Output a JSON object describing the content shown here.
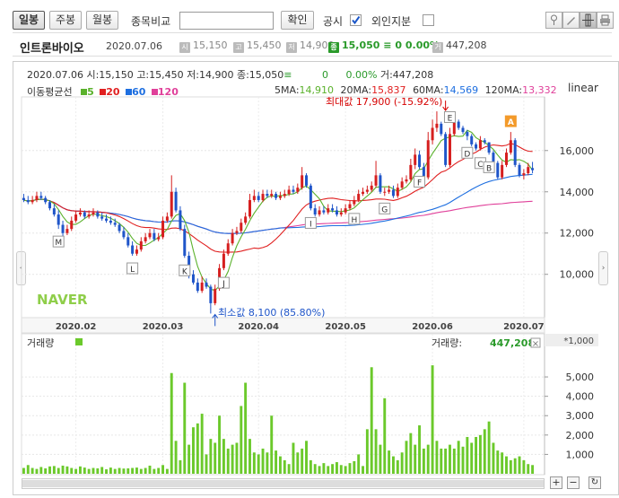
{
  "toolbar": {
    "tabs": [
      "일봉",
      "주봉",
      "월봉"
    ],
    "compare_label": "종목비교",
    "compare_value": "",
    "confirm_label": "확인",
    "notice_label": "공시",
    "notice_checked": true,
    "foreign_label": "외인지분",
    "foreign_checked": false,
    "tools": [
      "pin-icon",
      "pencil-icon",
      "crosshair-icon",
      "print-icon"
    ]
  },
  "stock": {
    "name": "인트론바이오",
    "date": "2020.07.06",
    "open_label": "시",
    "open": "15,150",
    "high_label": "고",
    "high": "15,450",
    "low_label": "저",
    "low": "14,900",
    "close_label": "종",
    "close": "15,050",
    "change_mark": "≡",
    "change": "0",
    "change_pct": "0.00%",
    "volume_label": "거",
    "volume": "447,208"
  },
  "info_line": {
    "date": "2020.07.06",
    "open": "시:15,150",
    "high": "고:15,450",
    "low": "저:14,900",
    "close": "종:15,050",
    "close_mark": "≡",
    "change": "0",
    "change_pct": "0.00%",
    "volume": "거:447,208"
  },
  "ma_legend": {
    "title": "이동평균선",
    "items": [
      {
        "label": "5",
        "color": "#5ab12b"
      },
      {
        "label": "20",
        "color": "#e02020"
      },
      {
        "label": "60",
        "color": "#1e6fe0"
      },
      {
        "label": "120",
        "color": "#e0409a"
      }
    ],
    "values": [
      {
        "label": "5MA:",
        "value": "14,910",
        "color": "#5ab12b"
      },
      {
        "label": "20MA:",
        "value": "15,837",
        "color": "#e02020"
      },
      {
        "label": "60MA:",
        "value": "14,569",
        "color": "#1e6fe0"
      },
      {
        "label": "120MA:",
        "value": "13,332",
        "color": "#e0409a"
      }
    ]
  },
  "scale_label": "linear",
  "max_annotation": "최대값 17,900 (-15.92%)",
  "min_annotation": "최소값 8,100 (85.80%)",
  "watermark": "NAVER",
  "volume_panel": {
    "title": "거래량",
    "value_label": "거래량:",
    "value": "447,208",
    "unit": "*1,000",
    "close_icon": "×"
  },
  "colors": {
    "up": "#d61f1f",
    "down": "#1f55c9",
    "ma5": "#5ab12b",
    "ma20": "#e02020",
    "ma60": "#1e6fe0",
    "ma120": "#e0409a",
    "volume": "#6bc92b"
  },
  "chart_data": {
    "type": "candlestick",
    "price_axis": {
      "ticks": [
        10000,
        12000,
        14000,
        16000
      ],
      "tick_labels": [
        "10,000",
        "12,000",
        "14,000",
        "16,000"
      ],
      "ylim": [
        7900,
        18600
      ]
    },
    "volume_axis": {
      "ticks": [
        1000,
        2000,
        3000,
        4000,
        5000
      ],
      "tick_labels": [
        "1,000",
        "2,000",
        "3,000",
        "4,000",
        "5,000"
      ],
      "ylim": [
        0,
        6300
      ]
    },
    "x_labels": [
      {
        "label": "2020.02",
        "index": 12
      },
      {
        "label": "2020.03",
        "index": 32
      },
      {
        "label": "2020.04",
        "index": 54
      },
      {
        "label": "2020.05",
        "index": 74
      },
      {
        "label": "2020.06",
        "index": 94
      },
      {
        "label": "2020.07",
        "index": 115
      }
    ],
    "close": [
      13600,
      13500,
      13600,
      13800,
      13700,
      13500,
      13200,
      12900,
      12400,
      12000,
      12200,
      12600,
      12900,
      13000,
      12800,
      12900,
      13000,
      12800,
      12700,
      12600,
      12500,
      12400,
      12100,
      11800,
      11400,
      11000,
      11200,
      11600,
      11800,
      12000,
      11700,
      11800,
      12600,
      12800,
      14000,
      13100,
      12200,
      10900,
      10000,
      9600,
      9200,
      9600,
      9400,
      8600,
      9300,
      10300,
      11000,
      11500,
      12000,
      12100,
      12500,
      12800,
      13600,
      13800,
      13600,
      13900,
      13800,
      13900,
      13700,
      13800,
      13900,
      14100,
      14000,
      14200,
      14800,
      14300,
      13200,
      12900,
      13100,
      13000,
      13200,
      13100,
      12900,
      13000,
      13200,
      13400,
      13600,
      13900,
      14000,
      14100,
      14300,
      14800,
      14000,
      14000,
      14100,
      13800,
      14200,
      14500,
      14600,
      15300,
      15800,
      15200,
      14700,
      16500,
      17100,
      17300,
      16800,
      15300,
      16800,
      17400,
      17100,
      16900,
      16700,
      16300,
      16100,
      16500,
      16400,
      15900,
      15400,
      14700,
      15300,
      15900,
      16500,
      15300,
      14800,
      14900,
      15200,
      15050
    ],
    "open": [
      13700,
      13600,
      13500,
      13600,
      13800,
      13700,
      13500,
      13200,
      12900,
      12400,
      12000,
      12200,
      12600,
      12900,
      13000,
      12800,
      12900,
      13000,
      12800,
      12700,
      12600,
      12500,
      12400,
      12100,
      11800,
      11400,
      11000,
      11200,
      11600,
      11800,
      12000,
      11700,
      11800,
      12600,
      12800,
      14000,
      13100,
      12200,
      10900,
      10000,
      9600,
      9200,
      9600,
      9400,
      8600,
      9300,
      10300,
      11000,
      11500,
      12000,
      12100,
      12500,
      12800,
      13600,
      13800,
      13600,
      13900,
      13800,
      13900,
      13700,
      13800,
      13900,
      14100,
      14000,
      14200,
      14800,
      14300,
      13200,
      12900,
      13100,
      13000,
      13200,
      13100,
      12900,
      13000,
      13200,
      13400,
      13600,
      13900,
      14000,
      14100,
      14300,
      14800,
      14000,
      14000,
      14100,
      13800,
      14200,
      14500,
      14600,
      15300,
      15800,
      15200,
      14700,
      16500,
      17100,
      17300,
      16800,
      15300,
      16800,
      17400,
      17100,
      16900,
      16700,
      16300,
      16100,
      16500,
      16400,
      15900,
      15400,
      14700,
      15300,
      15900,
      16500,
      15300,
      14800,
      14900,
      15150
    ],
    "high": [
      13900,
      13800,
      13800,
      14000,
      14000,
      13800,
      13600,
      13400,
      13100,
      12600,
      12400,
      12800,
      13100,
      13200,
      13100,
      13100,
      13200,
      13100,
      13000,
      12900,
      12800,
      12700,
      12500,
      12300,
      12000,
      11600,
      11400,
      11800,
      12000,
      12200,
      12200,
      12000,
      12800,
      13000,
      14800,
      14200,
      13300,
      12400,
      11100,
      10200,
      9800,
      9900,
      9800,
      9500,
      9500,
      10500,
      11200,
      11700,
      12200,
      12300,
      12700,
      13000,
      13900,
      14100,
      14000,
      14100,
      14100,
      14100,
      14000,
      14000,
      14100,
      14300,
      14300,
      14400,
      15200,
      14900,
      14400,
      13400,
      13300,
      13300,
      13400,
      13400,
      13300,
      13200,
      13400,
      13600,
      13800,
      14100,
      14200,
      14300,
      14500,
      15500,
      14900,
      14200,
      14300,
      14300,
      14400,
      14700,
      14800,
      15600,
      16100,
      16000,
      15400,
      16900,
      17500,
      17900,
      17400,
      16900,
      17100,
      17600,
      17500,
      17200,
      17000,
      16800,
      16400,
      16700,
      16600,
      16400,
      16000,
      15500,
      15500,
      16100,
      16900,
      16600,
      15400,
      15100,
      15400,
      15450
    ],
    "low": [
      13500,
      13400,
      13400,
      13500,
      13600,
      13400,
      13100,
      12800,
      12200,
      11800,
      11900,
      12100,
      12500,
      12800,
      12700,
      12700,
      12800,
      12700,
      12600,
      12500,
      12400,
      12300,
      12000,
      11700,
      11300,
      10900,
      10900,
      11100,
      11500,
      11700,
      11600,
      11600,
      11700,
      12500,
      12700,
      13000,
      12100,
      10800,
      9800,
      9500,
      9100,
      9100,
      9300,
      8100,
      8500,
      9200,
      10200,
      10900,
      11400,
      11900,
      12000,
      12400,
      12700,
      13500,
      13500,
      13500,
      13700,
      13700,
      13600,
      13600,
      13700,
      13800,
      13900,
      13900,
      14100,
      14200,
      13100,
      12800,
      12800,
      12900,
      12900,
      13000,
      12800,
      12800,
      12900,
      13100,
      13300,
      13500,
      13800,
      13900,
      14000,
      14200,
      13900,
      13800,
      13900,
      13700,
      13700,
      14100,
      14400,
      14500,
      15100,
      15100,
      14600,
      14600,
      16300,
      16900,
      16700,
      15200,
      15200,
      16700,
      17000,
      16800,
      16500,
      16200,
      16000,
      16000,
      16300,
      15800,
      15300,
      14600,
      14600,
      15200,
      15800,
      15200,
      14700,
      14600,
      14800,
      14900
    ],
    "volume": [
      300,
      450,
      300,
      250,
      350,
      280,
      380,
      400,
      300,
      420,
      380,
      300,
      250,
      380,
      320,
      250,
      300,
      280,
      350,
      230,
      320,
      250,
      300,
      270,
      280,
      300,
      320,
      250,
      300,
      420,
      250,
      300,
      450,
      250,
      5200,
      1700,
      700,
      4700,
      1500,
      2400,
      2600,
      3100,
      1000,
      1800,
      1600,
      3000,
      1800,
      1300,
      1500,
      1600,
      3500,
      4700,
      1800,
      1100,
      1000,
      1300,
      1100,
      3000,
      1200,
      900,
      700,
      500,
      1600,
      1100,
      1300,
      1700,
      700,
      500,
      400,
      550,
      400,
      500,
      600,
      450,
      400,
      550,
      650,
      1000,
      400,
      2300,
      5500,
      2300,
      1500,
      3900,
      1200,
      900,
      700,
      1100,
      1700,
      2100,
      1500,
      2500,
      1300,
      1500,
      5600,
      1700,
      1300,
      1300,
      1500,
      1300,
      1700,
      1400,
      1900,
      1600,
      1900,
      2000,
      2300,
      2700,
      1600,
      1200,
      1100,
      900,
      700,
      800,
      900,
      700,
      500,
      450
    ],
    "event_markers": [
      {
        "label": "M",
        "index": 8,
        "position": "below"
      },
      {
        "label": "L",
        "index": 25,
        "position": "below"
      },
      {
        "label": "K",
        "index": 37,
        "position": "below"
      },
      {
        "label": "J",
        "index": 46,
        "position": "below"
      },
      {
        "label": "I",
        "index": 66,
        "position": "below"
      },
      {
        "label": "H",
        "index": 76,
        "position": "below"
      },
      {
        "label": "G",
        "index": 83,
        "position": "below"
      },
      {
        "label": "F",
        "index": 91,
        "position": "below"
      },
      {
        "label": "E",
        "index": 98,
        "position": "above"
      },
      {
        "label": "D",
        "index": 102,
        "position": "below"
      },
      {
        "label": "C",
        "index": 105,
        "position": "below"
      },
      {
        "label": "B",
        "index": 107,
        "position": "below"
      },
      {
        "label": "A",
        "index": 112,
        "position": "above",
        "highlight": true
      }
    ],
    "max_point": {
      "index": 97,
      "value": 17900
    },
    "min_point": {
      "index": 44,
      "value": 8100
    }
  }
}
